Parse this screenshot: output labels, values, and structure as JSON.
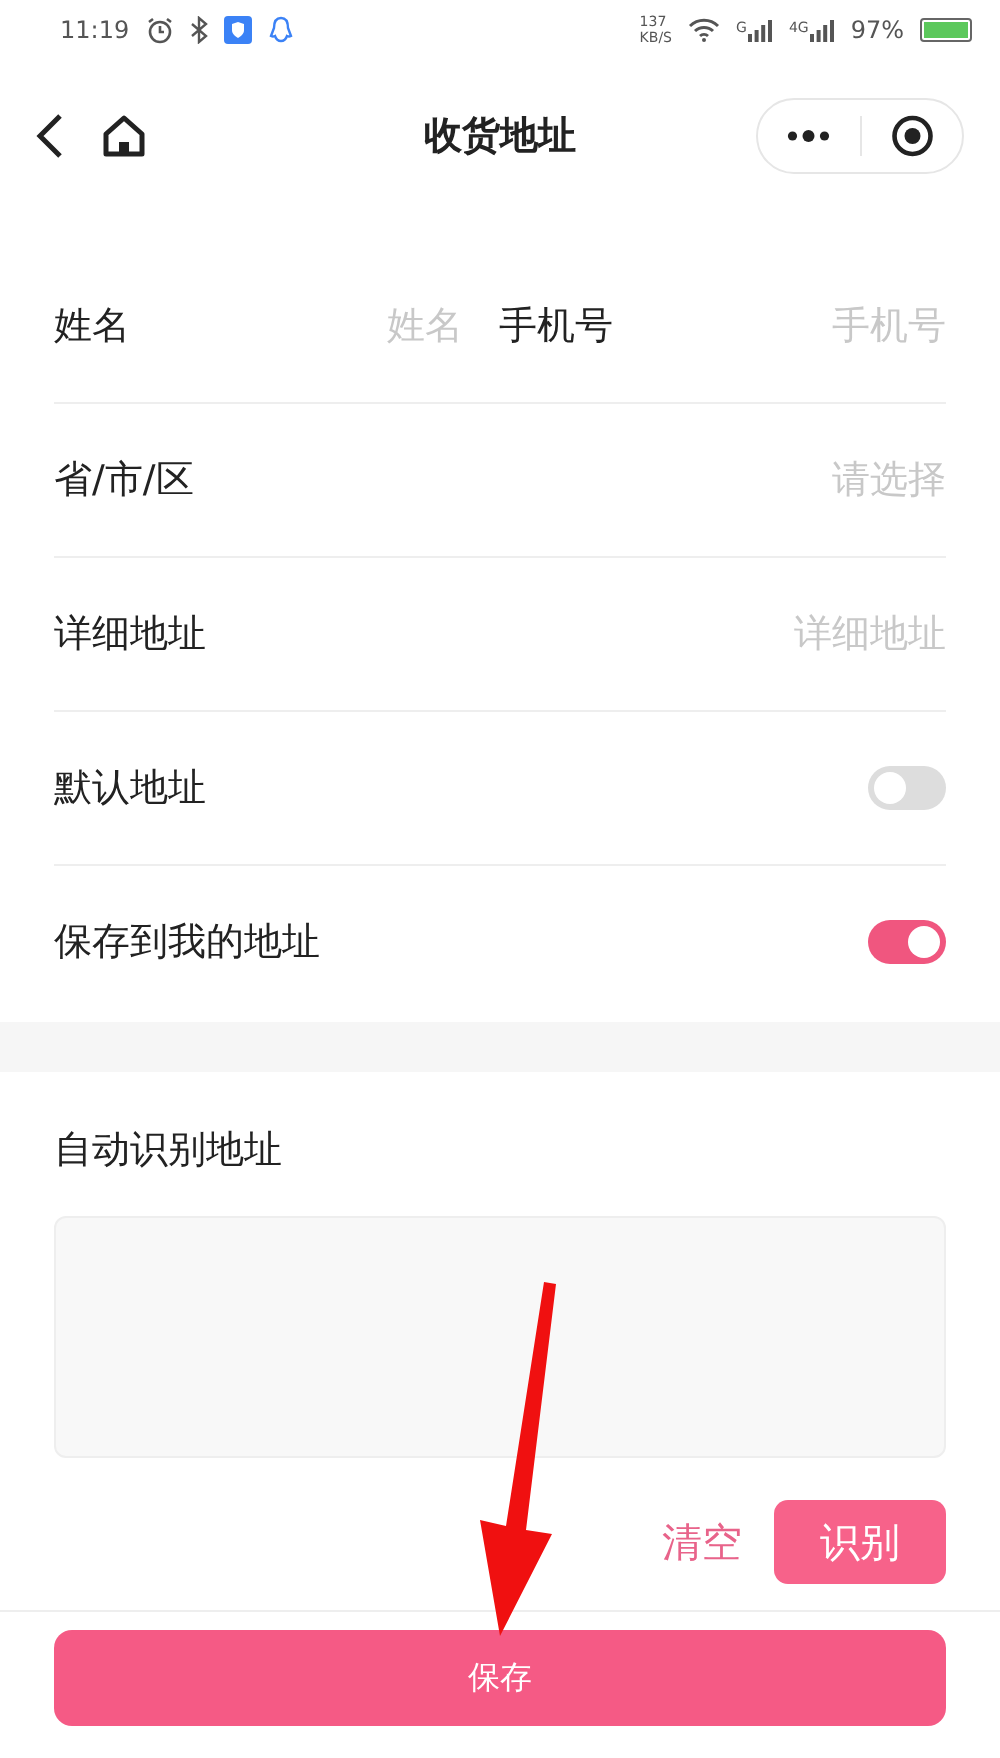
{
  "status_bar": {
    "time": "11:19",
    "speed": "137",
    "speed_unit": "KB/S",
    "signals": [
      {
        "label": "G"
      },
      {
        "label": "4G"
      }
    ],
    "battery": "97%"
  },
  "nav": {
    "title": "收货地址"
  },
  "form": {
    "rows": [
      {
        "kind": "pair",
        "fields": [
          {
            "label": "姓名",
            "placeholder": "姓名"
          },
          {
            "label": "手机号",
            "placeholder": "手机号"
          }
        ]
      },
      {
        "kind": "field",
        "label": "省/市/区",
        "placeholder": "请选择"
      },
      {
        "kind": "field",
        "label": "详细地址",
        "placeholder": "详细地址"
      },
      {
        "kind": "toggle",
        "label": "默认地址",
        "on": false
      },
      {
        "kind": "toggle",
        "label": "保存到我的地址",
        "on": true
      }
    ]
  },
  "auto_recognize": {
    "title": "自动识别地址",
    "clear_button": "清空",
    "recognize_button": "识别"
  },
  "save_button": "保存",
  "annotation": {
    "kind": "arrow"
  }
}
